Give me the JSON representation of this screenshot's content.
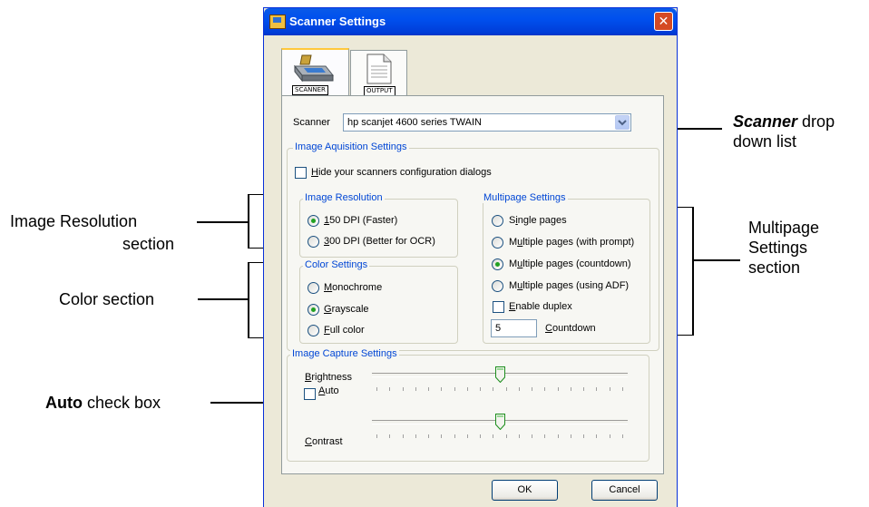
{
  "window": {
    "title": "Scanner Settings",
    "close_glyph": "✕"
  },
  "tabs": [
    {
      "label": "SCANNER",
      "icon": "scanner-icon"
    },
    {
      "label": "OUTPUT",
      "icon": "document-icon"
    }
  ],
  "scanner": {
    "label": "Scanner",
    "value": "hp scanjet 4600 series TWAIN"
  },
  "acquisition": {
    "group_label": "Image Aquisition Settings",
    "hide_dialogs_label_u": "H",
    "hide_dialogs_label_rest": "ide your scanners configuration dialogs",
    "hide_dialogs_checked": false
  },
  "resolution": {
    "group_label": "Image Resolution",
    "options": [
      {
        "u": "1",
        "rest": "50 DPI (Faster)",
        "selected": true
      },
      {
        "u": "3",
        "rest": "00 DPI (Better for OCR)",
        "selected": false
      }
    ]
  },
  "color": {
    "group_label": "Color Settings",
    "options": [
      {
        "u": "M",
        "rest": "onochrome",
        "selected": false
      },
      {
        "u": "G",
        "rest": "rayscale",
        "selected": true
      },
      {
        "u": "F",
        "rest": "ull color",
        "selected": false
      }
    ]
  },
  "multipage": {
    "group_label": "Multipage Settings",
    "options": [
      {
        "pre": "S",
        "u": "i",
        "rest": "ngle pages",
        "selected": false
      },
      {
        "pre": "M",
        "u": "u",
        "rest": "ltiple pages (with prompt)",
        "selected": false
      },
      {
        "pre": "M",
        "u": "u",
        "rest": "ltiple pages (countdown)",
        "selected": true
      },
      {
        "pre": "M",
        "u": "u",
        "rest": "ltiple pages (using ADF)",
        "selected": false
      }
    ],
    "duplex_u": "E",
    "duplex_rest": "nable duplex",
    "duplex_checked": false,
    "countdown_value": "5",
    "countdown_u": "C",
    "countdown_rest": "ountdown"
  },
  "capture": {
    "group_label": "Image Capture Settings",
    "brightness_u": "B",
    "brightness_rest": "rightness",
    "brightness_level": 0.5,
    "auto_u": "A",
    "auto_rest": "uto",
    "auto_checked": false,
    "contrast_u": "C",
    "contrast_rest": "ontrast",
    "contrast_level": 0.5
  },
  "buttons": {
    "ok": "OK",
    "cancel": "Cancel"
  },
  "callouts": {
    "scanner_bold": "Scanner",
    "scanner_rest": " drop",
    "scanner_line2": "down list",
    "resolution_line1": "Image Resolution",
    "resolution_line2": "section",
    "color": "Color section",
    "auto_bold": "Auto",
    "auto_rest": " check box",
    "multipage_line1": "Multipage",
    "multipage_line2": "Settings",
    "multipage_line3": "section"
  }
}
